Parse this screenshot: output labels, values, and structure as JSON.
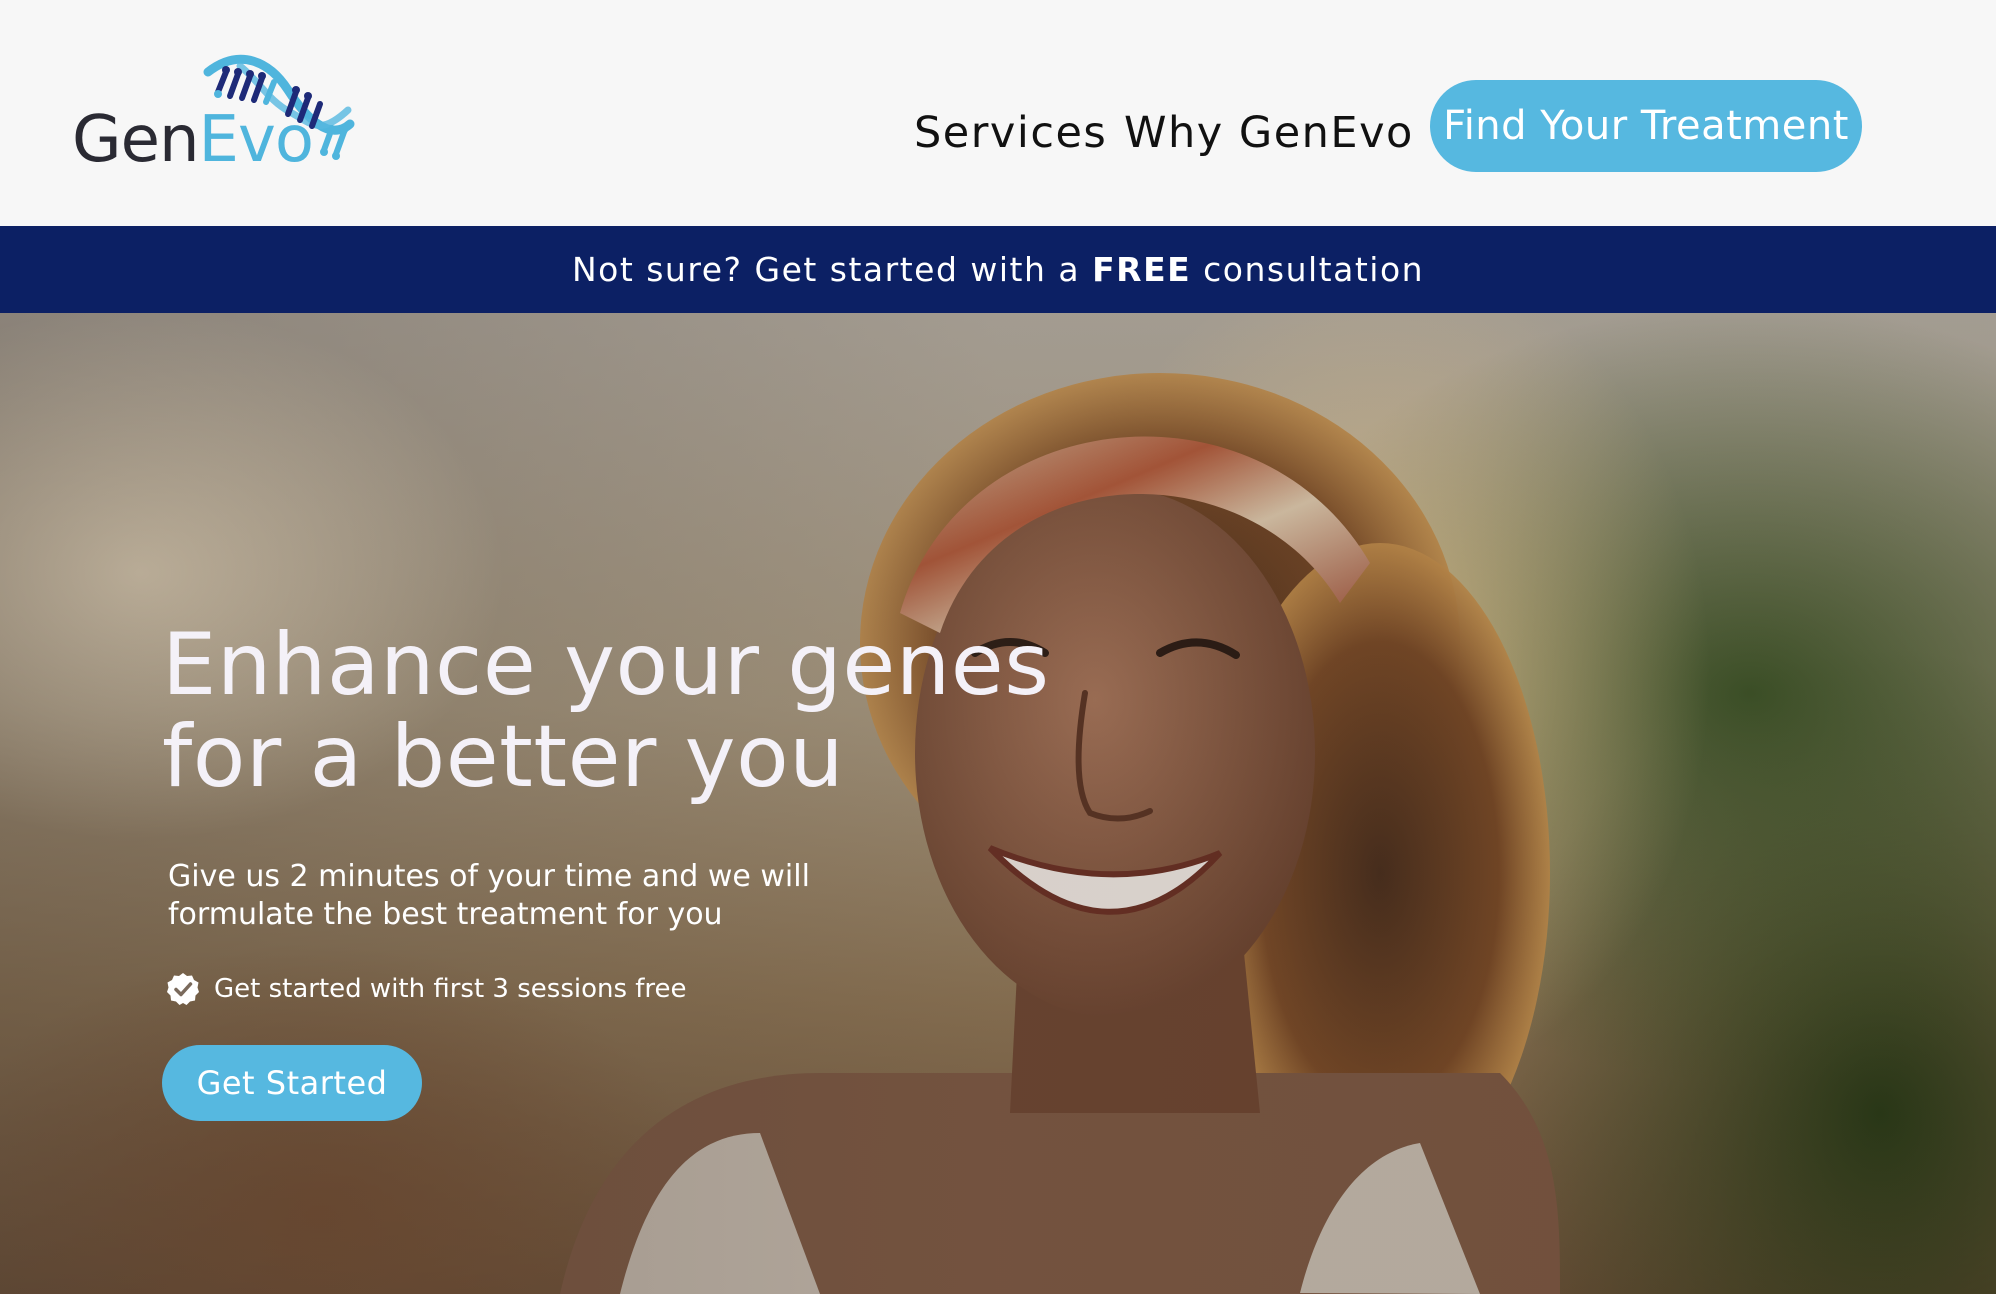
{
  "header": {
    "logo": {
      "part1": "Gen",
      "part2": "Evo"
    },
    "nav": [
      {
        "label": "Services"
      },
      {
        "label": "Why GenEvo"
      }
    ],
    "cta_label": "Find Your Treatment"
  },
  "promo": {
    "prefix": "Not sure? Get started with a ",
    "highlight": "FREE",
    "suffix": " consultation"
  },
  "hero": {
    "title_line1": "Enhance your genes",
    "title_line2": "for a better you",
    "subtitle_line1": "Give us 2 minutes of your time and we will",
    "subtitle_line2": "formulate the best treatment for you",
    "check_text": "Get started with first 3 sessions free",
    "button_label": "Get Started"
  },
  "colors": {
    "accent": "#56b8e0",
    "promo_bg": "#0c2064",
    "logo_dark": "#2a2a33",
    "logo_blue": "#4fb5dd",
    "helix_navy": "#1e2a78"
  },
  "icons": {
    "logo_mark": "dna-helix-icon",
    "check": "check-badge-icon"
  }
}
